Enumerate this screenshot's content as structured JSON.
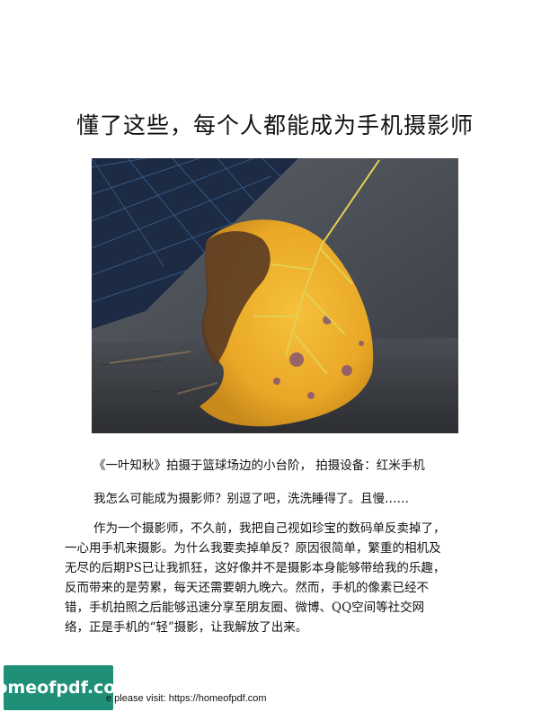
{
  "document": {
    "title": "懂了这些，每个人都能成为手机摄影师",
    "caption": "《一叶知秋》拍摄于篮球场边的小台阶， 拍摄设备：红米手机",
    "paragraph1": "我怎么可能成为摄影师？别逗了吧，洗洗睡得了。且慢……",
    "paragraph2_lines": [
      "作为一个摄影师，不久前，我把自己视如珍宝的数码单反卖掉了，",
      "一心用手机来摄影。为什么我要卖掉单反？原因很简单，繁重的相机及",
      "无尽的后期PS已让我抓狂，这好像并不是摄影本身能够带给我的乐趣，",
      "反而带来的是劳累，每天还需要朝九晚六。然而，手机的像素已经不",
      "错，手机拍照之后能够迅速分享至朋友圈、微博、QQ空间等社交网",
      "络，正是手机的“轻”摄影，让我解放了出来。"
    ]
  },
  "watermark": {
    "badge_text": "homeofpdf.com",
    "footer_text": "e please visit: https://homeofpdf.com"
  }
}
